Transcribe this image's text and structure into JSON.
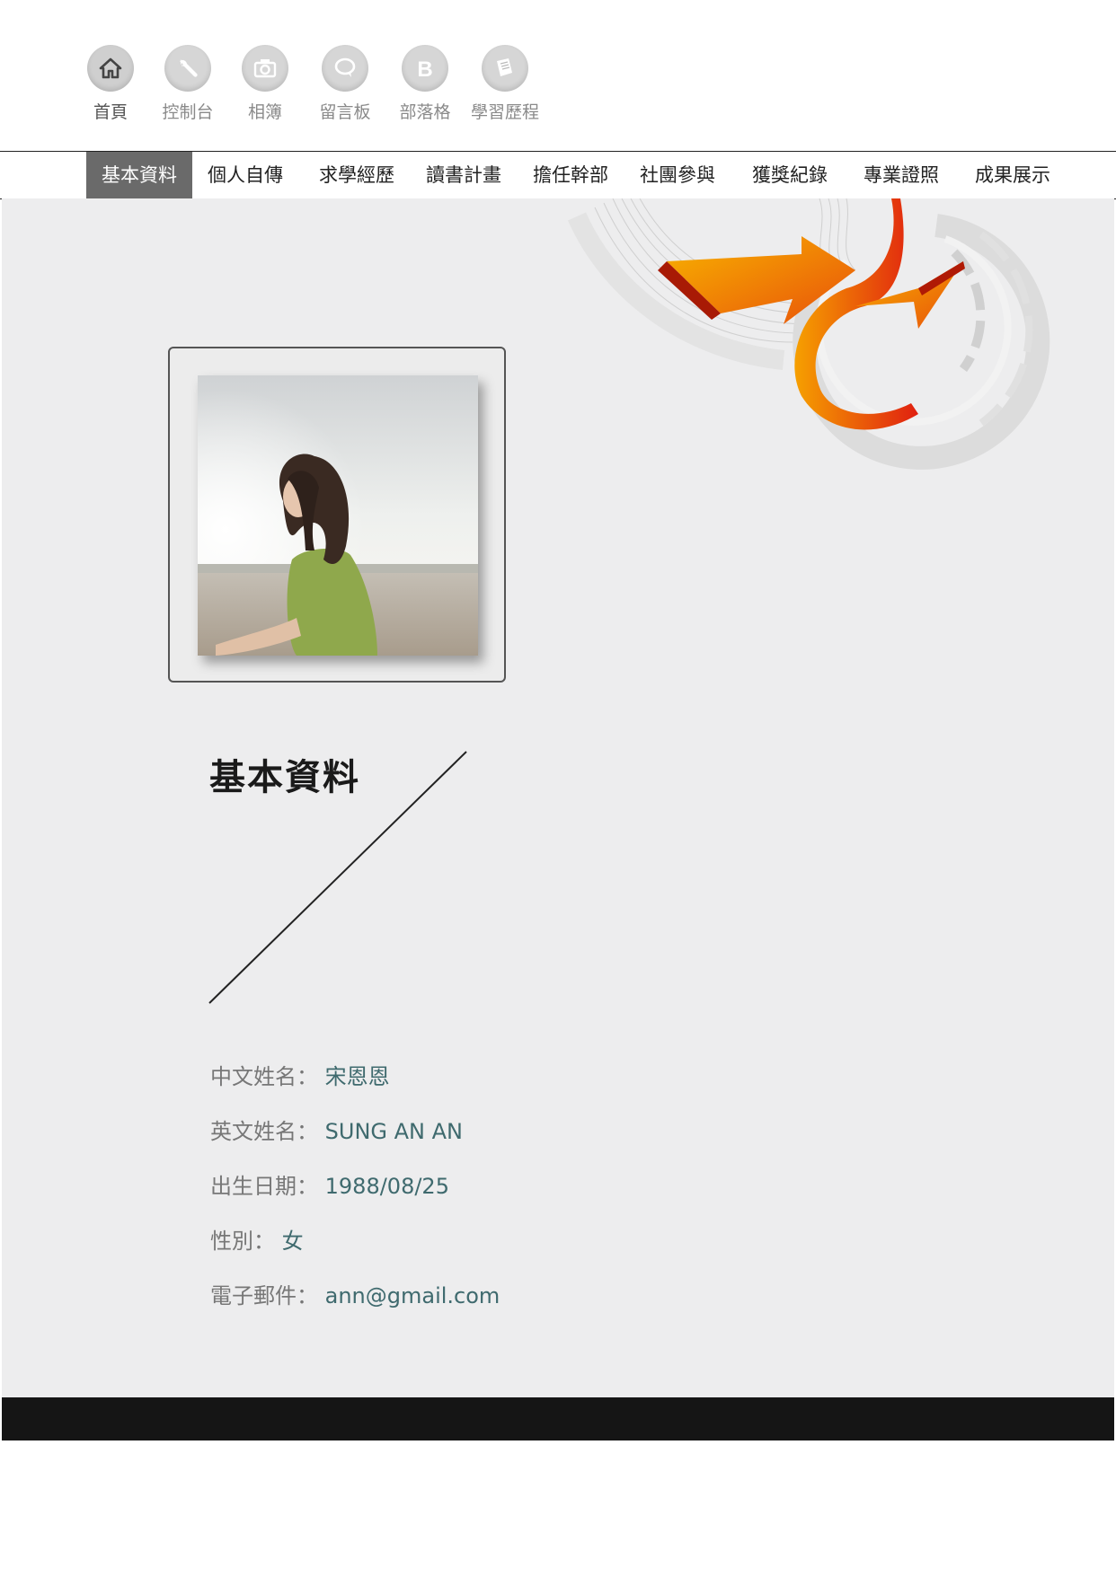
{
  "top_nav": [
    {
      "label": "首頁",
      "icon": "home-icon"
    },
    {
      "label": "控制台",
      "icon": "wrench-icon"
    },
    {
      "label": "相簿",
      "icon": "camera-icon"
    },
    {
      "label": "留言板",
      "icon": "chat-bubble-icon"
    },
    {
      "label": "部落格",
      "icon": "blog-b-icon"
    },
    {
      "label": "學習歷程",
      "icon": "document-icon"
    }
  ],
  "tabs": [
    "基本資料",
    "個人自傳",
    "求學經歷",
    "讀書計畫",
    "擔任幹部",
    "社團參與",
    "獲獎紀錄",
    "專業證照",
    "成果展示"
  ],
  "active_tab": "基本資料",
  "section_title": "基本資料",
  "profile": {
    "chinese_name_label": "中文姓名：",
    "chinese_name": "宋恩恩",
    "english_name_label": "英文姓名：",
    "english_name": "SUNG AN AN",
    "birthdate_label": "出生日期：",
    "birthdate": "1988/08/25",
    "gender_label": "性別：",
    "gender": "女",
    "email_label": "電子郵件：",
    "email": "ann@gmail.com"
  },
  "colors": {
    "panel": "#ededee",
    "active_tab": "#6a6a6a",
    "value_text": "#3f6a6e",
    "footer": "#151515",
    "arrow_orange": "#f08a10"
  }
}
